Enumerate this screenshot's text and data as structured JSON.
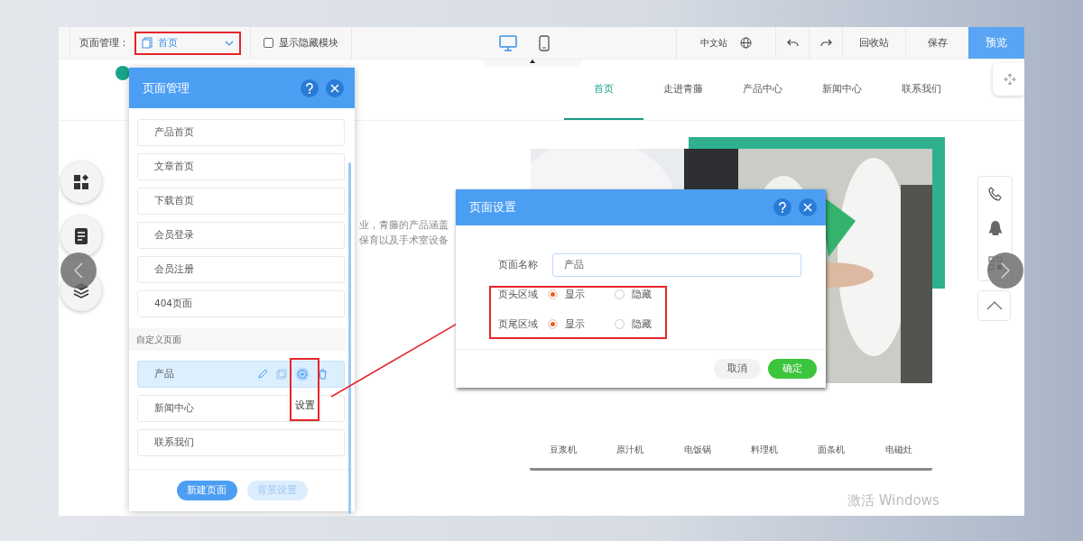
{
  "toolbar": {
    "label": "页面管理：",
    "page_select": "首页",
    "show_hidden": {
      "label": "显示隐藏模块",
      "checked": false
    },
    "devices": [
      {
        "kind": "desktop",
        "selected": true
      },
      {
        "kind": "mobile",
        "selected": false
      }
    ],
    "site": "中文站",
    "buttons": [
      "回收站",
      "保存"
    ],
    "preview": "预览"
  },
  "nav": [
    {
      "label": "首页",
      "selected": true
    },
    {
      "label": "走进青藤",
      "selected": false
    },
    {
      "label": "产品中心",
      "selected": false
    },
    {
      "label": "新闻中心",
      "selected": false
    },
    {
      "label": "联系我们",
      "selected": false
    }
  ],
  "background": {
    "right_fragments": [
      "业，青藤的产品涵盖",
      "保育以及手术室设备"
    ],
    "categories": [
      "豆浆机",
      "原汁机",
      "电饭锅",
      "料理机",
      "面条机",
      "电磁灶"
    ]
  },
  "page_manager": {
    "title": "页面管理",
    "pages": [
      "产品首页",
      "文章首页",
      "下载首页",
      "会员登录",
      "会员注册",
      "404页面"
    ],
    "section": "自定义页面",
    "custom_pages": [
      {
        "label": "产品",
        "selected": true
      },
      {
        "label": "新闻中心",
        "selected": false
      },
      {
        "label": "联系我们",
        "selected": false
      }
    ],
    "tooltip": "设置",
    "buttons": [
      "新建页面",
      "背景设置"
    ]
  },
  "dialog": {
    "title": "页面设置",
    "name_label": "页面名称",
    "name_value": "产品",
    "options": [
      {
        "label": "页头区域",
        "choices": [
          {
            "label": "显示",
            "selected": true
          },
          {
            "label": "隐藏",
            "selected": false
          }
        ]
      },
      {
        "label": "页尾区域",
        "choices": [
          {
            "label": "显示",
            "selected": true
          },
          {
            "label": "隐藏",
            "selected": false
          }
        ]
      }
    ],
    "buttons": [
      "取消",
      "确定"
    ]
  },
  "watermark": "激活 Windows"
}
